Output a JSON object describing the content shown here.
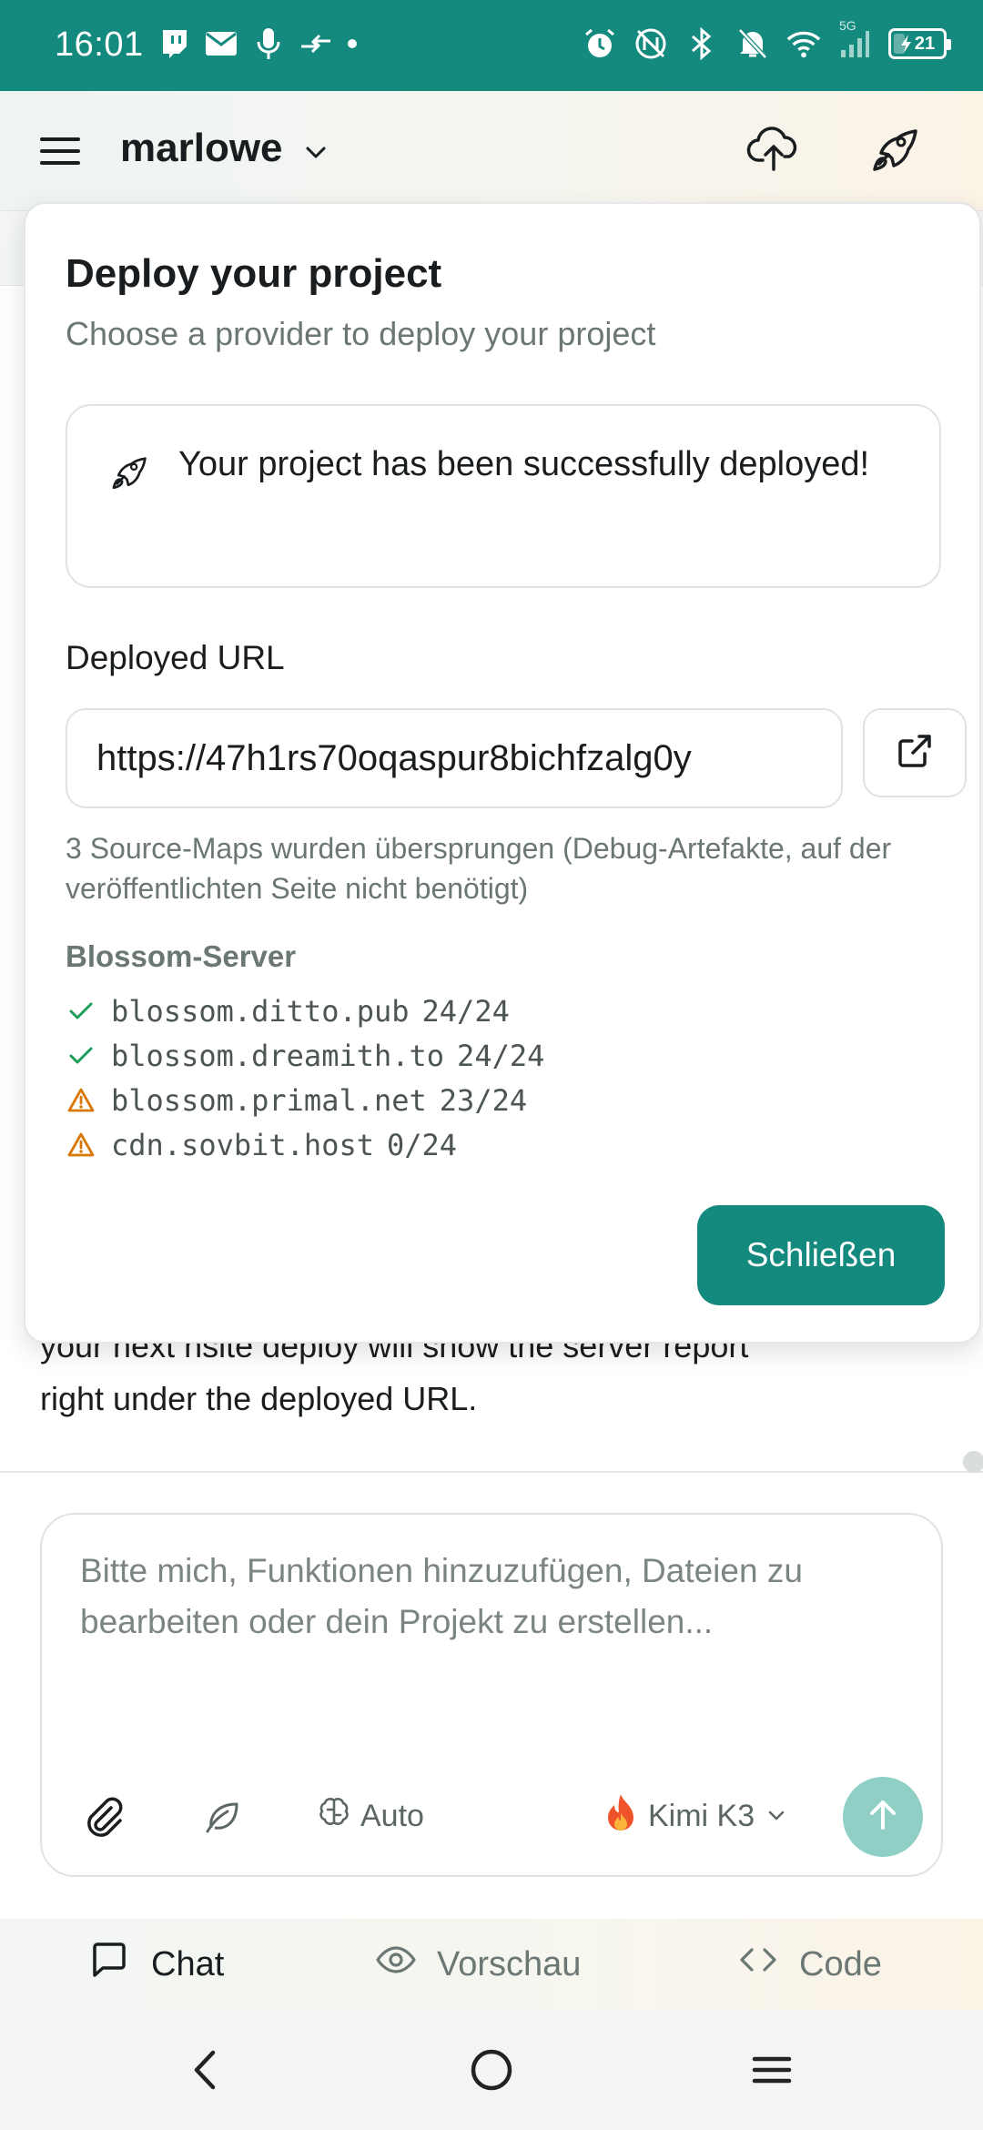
{
  "status_bar": {
    "time": "16:01",
    "battery": "21",
    "battery_level": 0.21,
    "network_badge": "5G",
    "left_icons": [
      "twitch-icon",
      "mail-icon",
      "mic-icon",
      "data-transfer-icon",
      "dot-icon"
    ],
    "right_icons": [
      "alarm-icon",
      "nfc-icon",
      "bluetooth-icon",
      "mute-icon",
      "wifi-icon",
      "signal-icon",
      "battery-icon"
    ]
  },
  "header": {
    "project_name": "marlowe"
  },
  "popover": {
    "title": "Deploy your project",
    "subtitle": "Choose a provider to deploy your project",
    "success_message": "Your project has been successfully deployed!",
    "url_label": "Deployed URL",
    "url_value": "https://47h1rs70oqaspur8bichfzalg0y",
    "note": "3 Source-Maps wurden übersprungen (Debug-Artefakte, auf der veröffentlichten Seite nicht benötigt)",
    "servers_title": "Blossom-Server",
    "servers": [
      {
        "host": "blossom.ditto.pub",
        "count": "24/24",
        "status": "ok"
      },
      {
        "host": "blossom.dreamith.to",
        "count": "24/24",
        "status": "ok"
      },
      {
        "host": "blossom.primal.net",
        "count": "23/24",
        "status": "warning"
      },
      {
        "host": "cdn.sovbit.host",
        "count": "0/24",
        "status": "warning"
      }
    ],
    "close_label": "Schließen"
  },
  "chat": {
    "partial_line": "your next nsite deploy will show the server report",
    "last_line": "right under the deployed URL."
  },
  "composer": {
    "placeholder": "Bitte mich, Funktionen hinzuzufügen, Dateien zu bearbeiten oder dein Projekt zu erstellen...",
    "mode_label": "Auto",
    "model_label": "Kimi K3"
  },
  "tabs": {
    "chat": "Chat",
    "preview": "Vorschau",
    "code": "Code"
  },
  "colors": {
    "primary": "#14897d",
    "success": "#1e9c5a",
    "warning": "#d97706"
  }
}
